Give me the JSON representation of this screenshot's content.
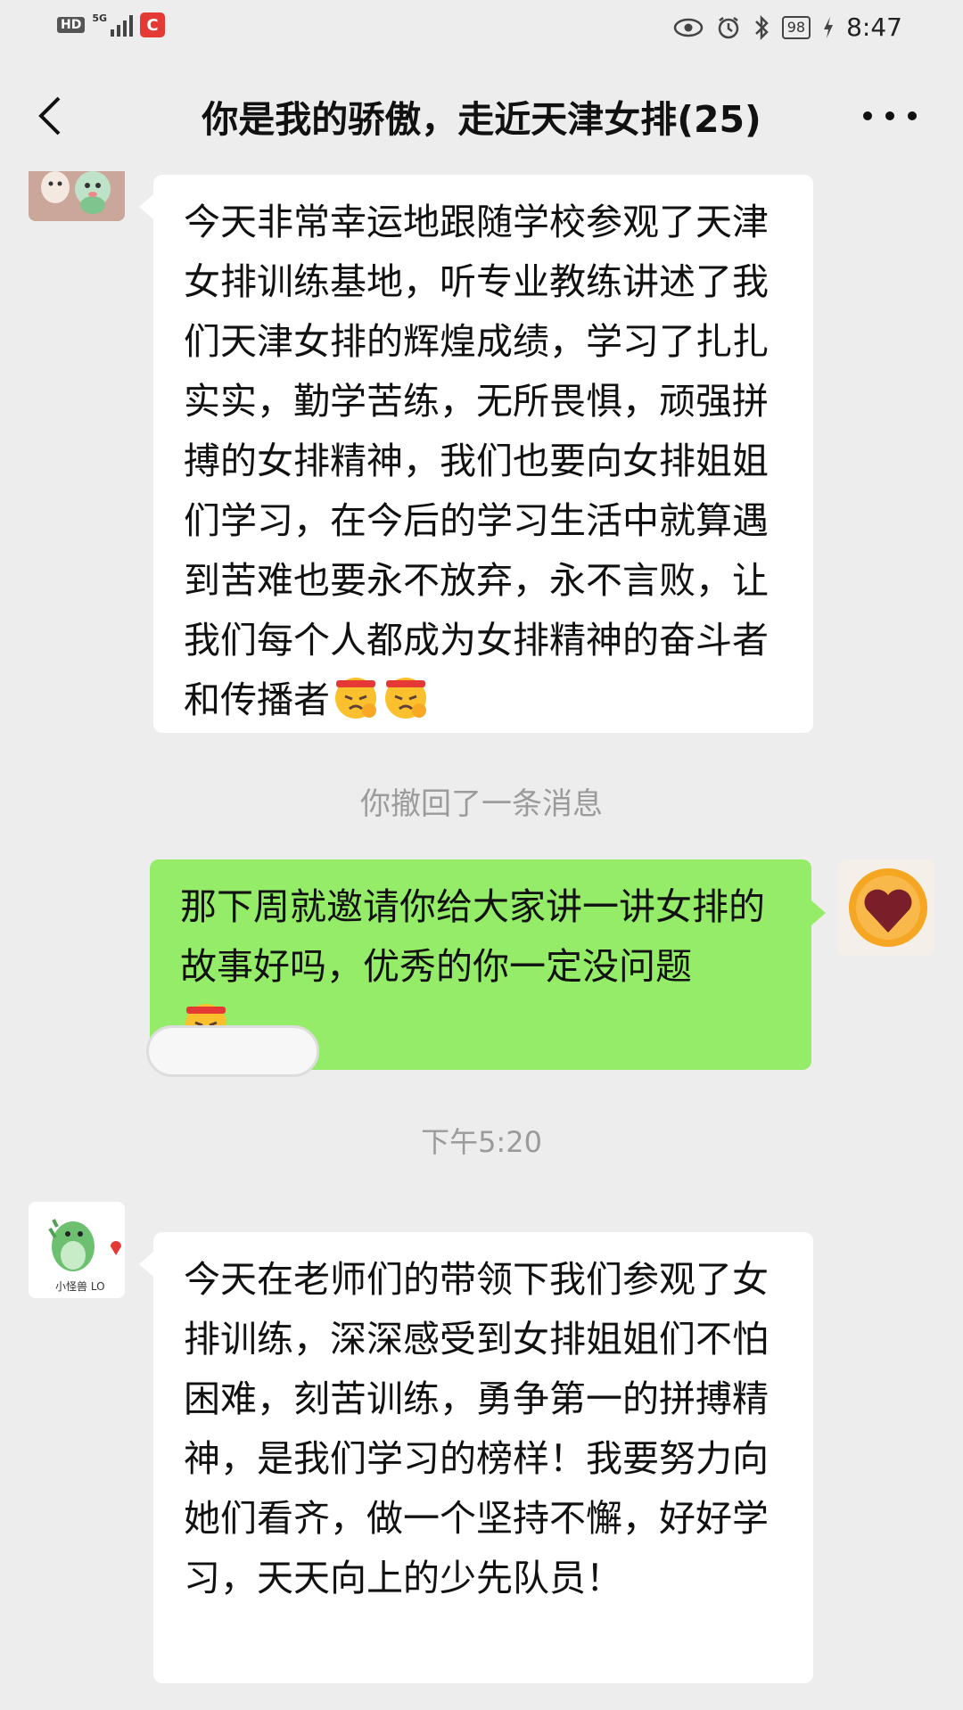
{
  "status_bar": {
    "hd": "HD",
    "network": "5G",
    "battery": "98",
    "time": "8:47"
  },
  "nav": {
    "title": "你是我的骄傲，走近天津女排(25)",
    "back_icon": "chevron-left-icon",
    "more_icon": "more-dots-icon"
  },
  "messages": {
    "msg1": {
      "sender": "other",
      "text": "今天非常幸运地跟随学校参观了天津女排训练基地，听专业教练讲述了我们天津女排的辉煌成绩，学习了扎扎实实，勤学苦练，无所畏惧，顽强拼搏的女排精神，我们也要向女排姐姐们学习，在今后的学习生活中就算遇到苦难也要永不放弃，永不言败，让我们每个人都成为女排精神的奋斗者和传播者",
      "emoji": "fighting-emoji"
    },
    "recall_notice": "你撤回了一条消息",
    "msg2": {
      "sender": "self",
      "text": "那下周就邀请你给大家讲一讲女排的故事好吗，优秀的你一定没问题",
      "emoji": "fighting-emoji"
    },
    "timestamp": "下午5:20",
    "msg3": {
      "sender": "other",
      "avatar_caption": "小怪兽 LO",
      "text": "今天在老师们的带领下我们参观了女排训练，深深感受到女排姐姐们不怕困难，刻苦训练，勇争第一的拼搏精神，是我们学习的榜样！我要努力向她们看齐，做一个坚持不懈，好好学习，天天向上的少先队员！"
    }
  },
  "colors": {
    "background": "#ededed",
    "bubble_self": "#95ec69",
    "bubble_other": "#ffffff",
    "system_text": "#9b9b9b"
  }
}
